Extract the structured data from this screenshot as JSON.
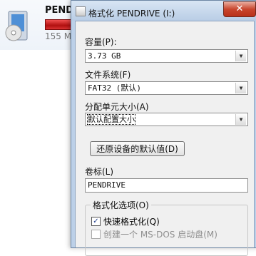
{
  "background": {
    "drive_name": "PENDRIVE",
    "free_text": "155 M",
    "capacity_fraction": 0.9
  },
  "dialog": {
    "title": "格式化 PENDRIVE (I:)",
    "close_icon": "✕",
    "capacity": {
      "label": "容量(P):",
      "value": "3.73 GB"
    },
    "filesystem": {
      "label": "文件系统(F)",
      "value": "FAT32 (默认)"
    },
    "allocation": {
      "label": "分配单元大小(A)",
      "value": "默认配置大小"
    },
    "restore_button": "还原设备的默认值(D)",
    "volume": {
      "label": "卷标(L)",
      "value": "PENDRIVE"
    },
    "options": {
      "title": "格式化选项(O)",
      "quick_format": {
        "label": "快速格式化(Q)",
        "checked": true
      },
      "msdos_disk": {
        "label": "创建一个 MS-DOS 启动盘(M)",
        "checked": false,
        "enabled": false
      }
    }
  }
}
